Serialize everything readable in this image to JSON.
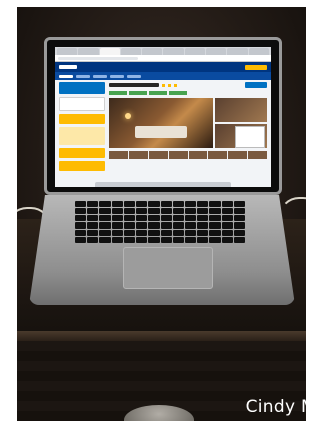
{
  "photo": {
    "watermark": "Cindy M"
  },
  "colors": {
    "booking_blue": "#003580",
    "booking_yellow": "#febb02",
    "room_warm": "#c48a4a"
  }
}
